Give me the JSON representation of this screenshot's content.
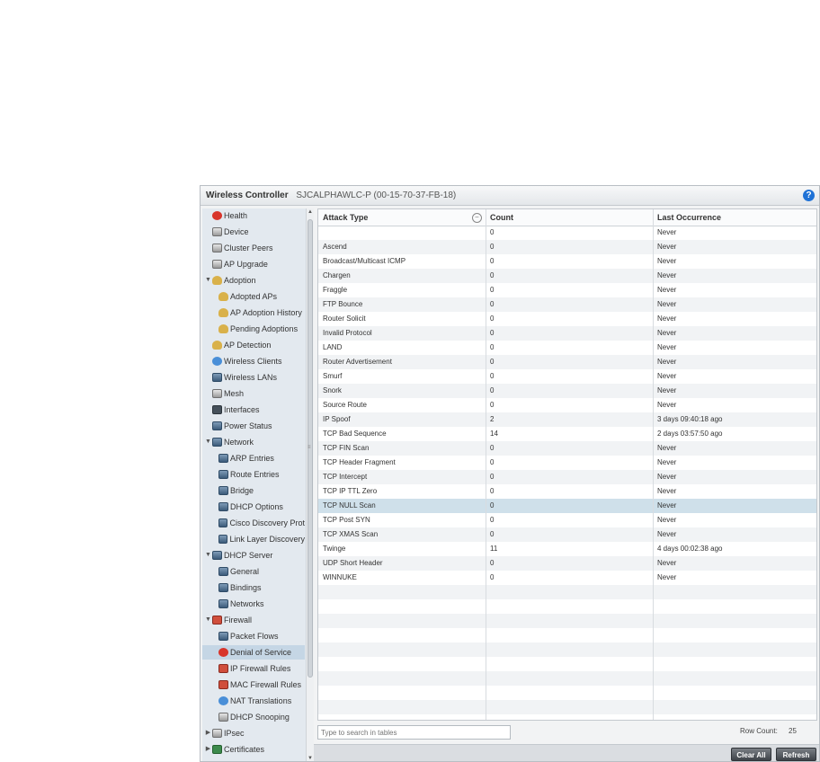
{
  "window": {
    "app_title": "Wireless Controller",
    "device": "SJCALPHAWLC-P (00-15-70-37-FB-18)",
    "help_icon": "?"
  },
  "tree": [
    {
      "label": "Health",
      "icon": "health-icon",
      "icls": "ico-red",
      "level": 0
    },
    {
      "label": "Device",
      "icon": "device-icon",
      "icls": "ico-grey",
      "level": 0
    },
    {
      "label": "Cluster Peers",
      "icon": "cluster-peers-icon",
      "icls": "ico-grey",
      "level": 0
    },
    {
      "label": "AP Upgrade",
      "icon": "ap-upgrade-icon",
      "icls": "ico-grey",
      "level": 0
    },
    {
      "label": "Adoption",
      "icon": "adoption-icon",
      "icls": "ico-gold",
      "level": 0,
      "tw": "▼"
    },
    {
      "label": "Adopted APs",
      "icon": "adopted-aps-icon",
      "icls": "ico-gold",
      "level": 1
    },
    {
      "label": "AP Adoption History",
      "icon": "adoption-history-icon",
      "icls": "ico-gold",
      "level": 1
    },
    {
      "label": "Pending Adoptions",
      "icon": "pending-adoptions-icon",
      "icls": "ico-gold",
      "level": 1
    },
    {
      "label": "AP Detection",
      "icon": "ap-detection-icon",
      "icls": "ico-gold",
      "level": 0
    },
    {
      "label": "Wireless Clients",
      "icon": "wireless-clients-icon",
      "icls": "ico-blue",
      "level": 0
    },
    {
      "label": "Wireless LANs",
      "icon": "wireless-lans-icon",
      "icls": "ico-net",
      "level": 0
    },
    {
      "label": "Mesh",
      "icon": "mesh-icon",
      "icls": "ico-grey",
      "level": 0
    },
    {
      "label": "Interfaces",
      "icon": "interfaces-icon",
      "icls": "ico-dark",
      "level": 0
    },
    {
      "label": "Power Status",
      "icon": "power-status-icon",
      "icls": "ico-net",
      "level": 0
    },
    {
      "label": "Network",
      "icon": "network-icon",
      "icls": "ico-net",
      "level": 0,
      "tw": "▼"
    },
    {
      "label": "ARP Entries",
      "icon": "arp-entries-icon",
      "icls": "ico-net",
      "level": 1
    },
    {
      "label": "Route Entries",
      "icon": "route-entries-icon",
      "icls": "ico-net",
      "level": 1
    },
    {
      "label": "Bridge",
      "icon": "bridge-icon",
      "icls": "ico-net",
      "level": 1
    },
    {
      "label": "DHCP Options",
      "icon": "dhcp-options-icon",
      "icls": "ico-net",
      "level": 1
    },
    {
      "label": "Cisco Discovery Prot",
      "icon": "cisco-discovery-icon",
      "icls": "ico-net",
      "level": 1
    },
    {
      "label": "Link Layer Discovery",
      "icon": "link-layer-discovery-icon",
      "icls": "ico-net",
      "level": 1
    },
    {
      "label": "DHCP Server",
      "icon": "dhcp-server-icon",
      "icls": "ico-net",
      "level": 0,
      "tw": "▼"
    },
    {
      "label": "General",
      "icon": "general-icon",
      "icls": "ico-net",
      "level": 1
    },
    {
      "label": "Bindings",
      "icon": "bindings-icon",
      "icls": "ico-net",
      "level": 1
    },
    {
      "label": "Networks",
      "icon": "networks-icon",
      "icls": "ico-net",
      "level": 1
    },
    {
      "label": "Firewall",
      "icon": "firewall-icon",
      "icls": "ico-fire",
      "level": 0,
      "tw": "▼"
    },
    {
      "label": "Packet Flows",
      "icon": "packet-flows-icon",
      "icls": "ico-net",
      "level": 1
    },
    {
      "label": "Denial of Service",
      "icon": "denial-of-service-icon",
      "icls": "ico-red",
      "level": 1,
      "selected": true
    },
    {
      "label": "IP Firewall Rules",
      "icon": "ip-firewall-rules-icon",
      "icls": "ico-fire",
      "level": 1
    },
    {
      "label": "MAC Firewall Rules",
      "icon": "mac-firewall-rules-icon",
      "icls": "ico-fire",
      "level": 1
    },
    {
      "label": "NAT Translations",
      "icon": "nat-translations-icon",
      "icls": "ico-blue",
      "level": 1
    },
    {
      "label": "DHCP Snooping",
      "icon": "dhcp-snooping-icon",
      "icls": "ico-grey",
      "level": 1
    },
    {
      "label": "IPsec",
      "icon": "ipsec-icon",
      "icls": "ico-grey",
      "level": 0,
      "tw": "▶"
    },
    {
      "label": "Certificates",
      "icon": "certificates-icon",
      "icls": "ico-cert",
      "level": 0,
      "tw": "▶"
    }
  ],
  "table": {
    "columns": [
      "Attack Type",
      "Count",
      "Last Occurrence"
    ],
    "rows": [
      [
        "",
        "0",
        "Never"
      ],
      [
        "Ascend",
        "0",
        "Never"
      ],
      [
        "Broadcast/Multicast ICMP",
        "0",
        "Never"
      ],
      [
        "Chargen",
        "0",
        "Never"
      ],
      [
        "Fraggle",
        "0",
        "Never"
      ],
      [
        "FTP Bounce",
        "0",
        "Never"
      ],
      [
        "Router Solicit",
        "0",
        "Never"
      ],
      [
        "Invalid Protocol",
        "0",
        "Never"
      ],
      [
        "LAND",
        "0",
        "Never"
      ],
      [
        "Router Advertisement",
        "0",
        "Never"
      ],
      [
        "Smurf",
        "0",
        "Never"
      ],
      [
        "Snork",
        "0",
        "Never"
      ],
      [
        "Source Route",
        "0",
        "Never"
      ],
      [
        "IP Spoof",
        "2",
        "3 days 09:40:18 ago"
      ],
      [
        "TCP Bad Sequence",
        "14",
        "2 days 03:57:50 ago"
      ],
      [
        "TCP FIN Scan",
        "0",
        "Never"
      ],
      [
        "TCP Header Fragment",
        "0",
        "Never"
      ],
      [
        "TCP Intercept",
        "0",
        "Never"
      ],
      [
        "TCP IP TTL Zero",
        "0",
        "Never"
      ],
      [
        "TCP NULL Scan",
        "0",
        "Never"
      ],
      [
        "TCP Post SYN",
        "0",
        "Never"
      ],
      [
        "TCP XMAS Scan",
        "0",
        "Never"
      ],
      [
        "Twinge",
        "11",
        "4 days 00:02:38 ago"
      ],
      [
        "UDP Short Header",
        "0",
        "Never"
      ],
      [
        "WINNUKE",
        "0",
        "Never"
      ]
    ],
    "selected_row": "TCP NULL Scan"
  },
  "footer": {
    "search_placeholder": "Type to search in tables",
    "row_count_label": "Row Count:",
    "row_count": "25",
    "clear_all": "Clear All",
    "refresh": "Refresh"
  }
}
